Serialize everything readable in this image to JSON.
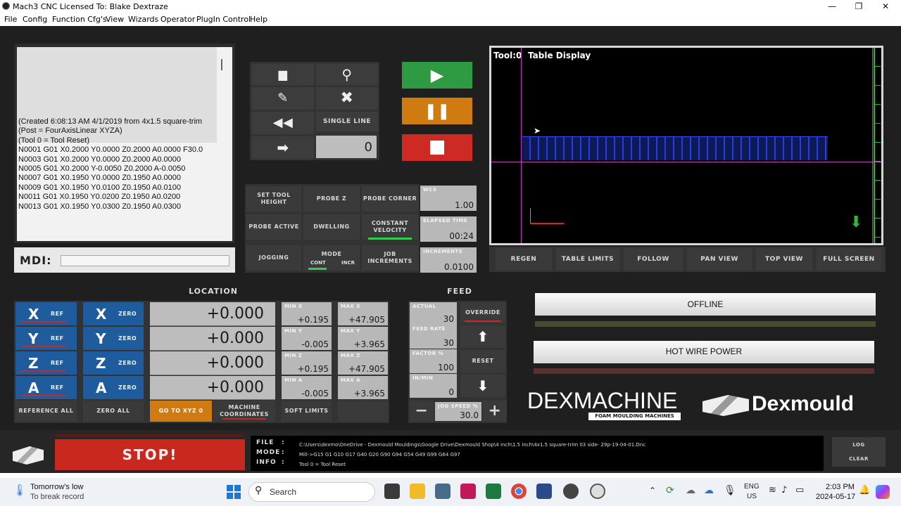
{
  "window": {
    "title": "Mach3 CNC  Licensed To: Blake Dextraze",
    "min": "—",
    "max": "❐",
    "close": "✕"
  },
  "menu": [
    "File",
    "Config",
    "Function Cfg's",
    "View",
    "Wizards",
    "Operator",
    "PlugIn Control",
    "Help"
  ],
  "gcode_lines": [
    "(Created 6:08:13 AM 4/1/2019 from 4x1.5 square-trim",
    "(Post = FourAxisLinear XYZA)",
    "(Tool 0 = Tool Reset)",
    "N0001 G01 X0.2000 Y0.0000 Z0.2000 A0.0000 F30.0",
    "N0003 G01 X0.2000 Y0.0000 Z0.2000 A0.0000",
    "N0005 G01 X0.2000 Y-0.0050 Z0.2000 A-0.0050",
    "N0007 G01 X0.1950 Y0.0000 Z0.1950 A0.0000",
    "N0009 G01 X0.1950 Y0.0100 Z0.1950 A0.0100",
    "N0011 G01 X0.1950 Y0.0200 Z0.1950 A0.0200",
    "N0013 G01 X0.1950 Y0.0300 Z0.1950 A0.0300"
  ],
  "mdi": {
    "label": "MDI:"
  },
  "file_controls": {
    "single_line": "SINGLE LINE",
    "line_value": "0"
  },
  "mid_buttons": {
    "set_tool_height": "SET TOOL HEIGHT",
    "probe_z": "PROBE Z",
    "probe_corner": "PROBE CORNER",
    "probe_active": "PROBE ACTIVE",
    "dwelling": "DWELLING",
    "constant_velocity": "CONSTANT VELOCITY",
    "jogging": "JOGGING",
    "mode": "MODE",
    "cont": "CONT",
    "incr": "INCR",
    "job_increments": "JOB INCREMENTS"
  },
  "readouts": {
    "wcs_label": "WCS",
    "wcs_value": "1.00",
    "elapsed_label": "ELAPSED TIME",
    "elapsed_value": "00:24",
    "increments_label": "INCREMENTS",
    "increments_value": "0.0100"
  },
  "toolpath": {
    "tool": "Tool:0",
    "title": "Table Display"
  },
  "view_buttons": [
    "REGEN",
    "TABLE LIMITS",
    "FOLLOW",
    "PAN VIEW",
    "TOP VIEW",
    "FULL SCREEN"
  ],
  "location": {
    "header": "LOCATION",
    "ref": "REF",
    "zero": "ZERO",
    "axes": [
      "X",
      "Y",
      "Z",
      "A"
    ],
    "values": [
      "+0.000",
      "+0.000",
      "+0.000",
      "+0.000"
    ],
    "reference_all": "REFERENCE ALL",
    "zero_all": "ZERO ALL",
    "goto": "GO TO XYZ 0",
    "machine_coords": "MACHINE COORDINATES",
    "soft_limits": "SOFT LIMITS"
  },
  "limits": {
    "min": [
      {
        "l": "MIN X",
        "v": "+0.195"
      },
      {
        "l": "MIN Y",
        "v": "-0.005"
      },
      {
        "l": "MIN Z",
        "v": "+0.195"
      },
      {
        "l": "MIN A",
        "v": "-0.005"
      }
    ],
    "max": [
      {
        "l": "MAX X",
        "v": "+47.905"
      },
      {
        "l": "MAX Y",
        "v": "+3.965"
      },
      {
        "l": "MAX Z",
        "v": "+47.905"
      },
      {
        "l": "MAX A",
        "v": "+3.965"
      }
    ]
  },
  "feed": {
    "header": "FEED",
    "actual_l": "ACTUAL",
    "actual_v": "30",
    "feedrate_l": "FEED RATE",
    "feedrate_v": "30",
    "factor_l": "FACTOR %",
    "factor_v": "100",
    "inmin_l": "IN/MIN",
    "inmin_v": "0",
    "override": "OVERRIDE",
    "reset": "RESET",
    "jog_l": "JOG SPEED %",
    "jog_v": "30.0"
  },
  "status": {
    "offline": "OFFLINE",
    "hotwire": "HOT WIRE POWER"
  },
  "brand": {
    "dexmachine": "DEXMACHINE",
    "tagline": "FOAM MOULDING MACHINES",
    "dexmould": "Dexmould"
  },
  "stop": "STOP!",
  "info": {
    "file_k": "FILE",
    "file_v": "C:\\Users\\dexmo\\OneDrive - Dexmould Mouldings\\Google Drive\\Dexmould Shop\\4 inch\\1.5 inch\\4x1.5 square-trim 03 side- 29p-19-04-01.Dnc",
    "mode_k": "MODE",
    "mode_v": "Mill->G15  G1 G10 G17 G40 G20 G90 G94 G54 G49 G99 G64 G97",
    "info_k": "INFO",
    "info_v": "Tool 0 = Tool Reset",
    "sep": ":"
  },
  "log": {
    "log": "LOG",
    "clear": "CLEAR"
  },
  "taskbar": {
    "weather1": "Tomorrow's low",
    "weather2": "To break record",
    "search": "Search",
    "lang1": "ENG",
    "lang2": "US",
    "time": "2:03 PM",
    "date": "2024-05-17"
  },
  "colors": {
    "start": "#2e9a42",
    "pause": "#d07a12",
    "stop": "#cc2a22",
    "axis_blue": "#1f5c9e",
    "stop_big": "#c8281e"
  }
}
